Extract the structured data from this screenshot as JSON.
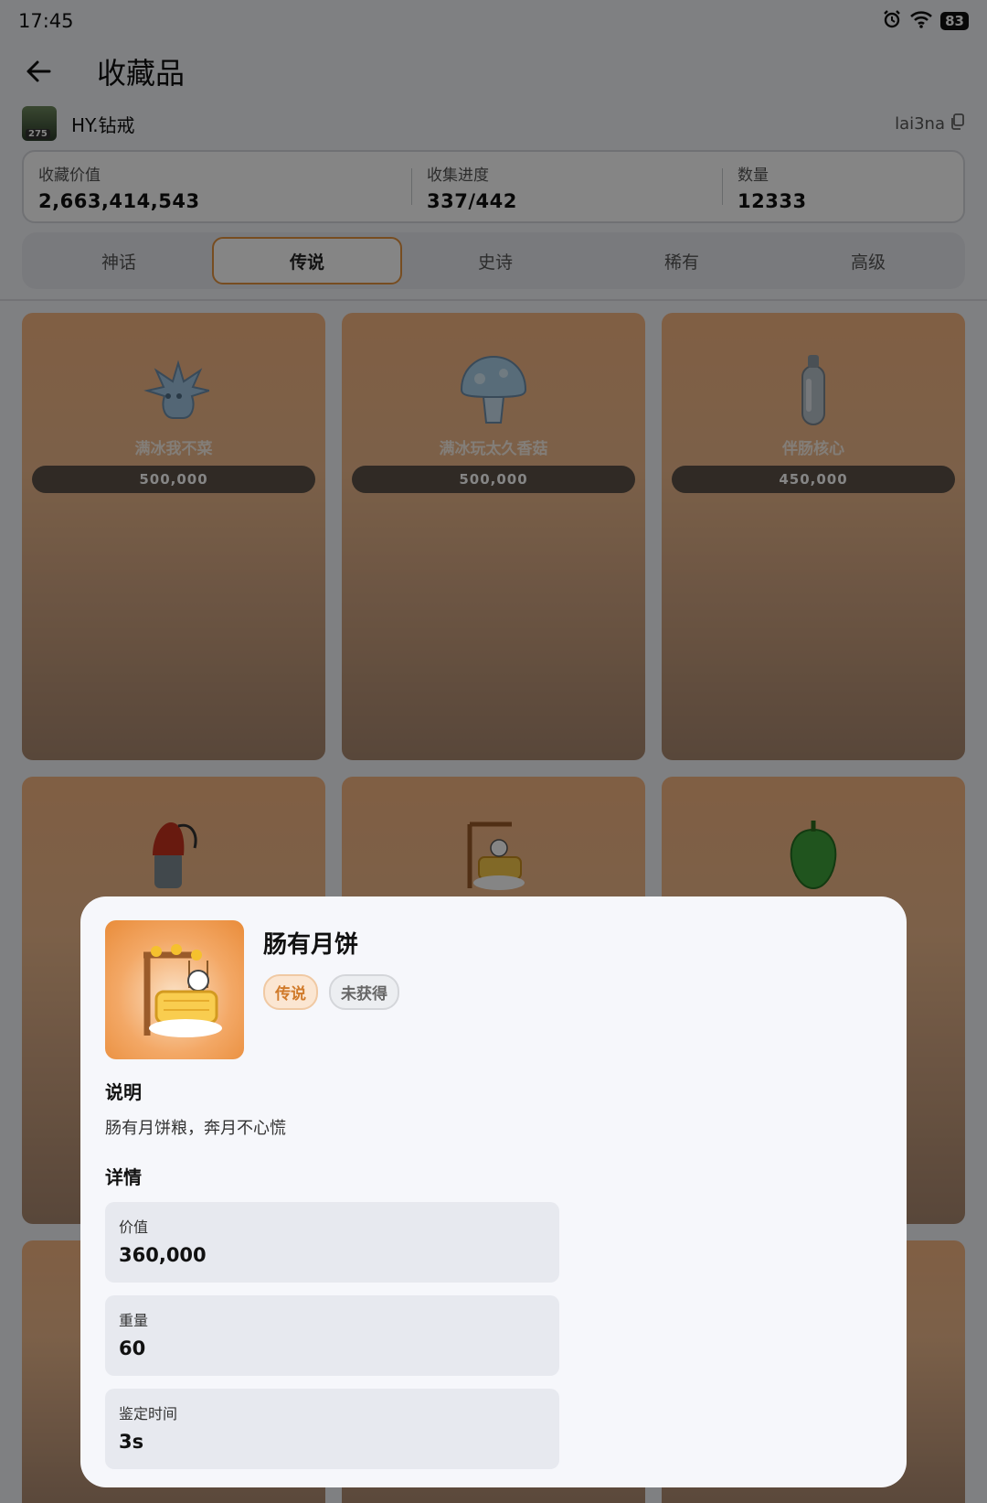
{
  "status_bar": {
    "time": "17:45",
    "battery": "83"
  },
  "header": {
    "title": "收藏品"
  },
  "user": {
    "name": "HY.钻戒",
    "level": "275",
    "id": "lai3na"
  },
  "stats": [
    {
      "label": "收藏价值",
      "value": "2,663,414,543"
    },
    {
      "label": "收集进度",
      "value": "337/442"
    },
    {
      "label": "数量",
      "value": "12333"
    }
  ],
  "tabs": [
    {
      "label": "神话",
      "active": false
    },
    {
      "label": "传说",
      "active": true
    },
    {
      "label": "史诗",
      "active": false
    },
    {
      "label": "稀有",
      "active": false
    },
    {
      "label": "高级",
      "active": false
    }
  ],
  "cards": [
    {
      "name": "满冰我不菜",
      "price": "500,000",
      "icon": "ice-bird-icon"
    },
    {
      "name": "满冰玩太久香菇",
      "price": "500,000",
      "icon": "ice-mushroom-icon"
    },
    {
      "name": "伴肠核心",
      "price": "450,000",
      "icon": "capsule-icon"
    },
    {
      "icon": "sausage-bomb-icon"
    },
    {
      "icon": "mooncake-swing-icon"
    },
    {
      "icon": "green-pepper-icon"
    }
  ],
  "modal": {
    "title": "肠有月饼",
    "rarity": "传说",
    "status": "未获得",
    "description_heading": "说明",
    "description": "肠有月饼粮，奔月不心慌",
    "details_heading": "详情",
    "details": [
      {
        "label": "价值",
        "value": "360,000"
      },
      {
        "label": "重量",
        "value": "60"
      },
      {
        "label": "鉴定时间",
        "value": "3s"
      }
    ]
  },
  "colors": {
    "accent": "#e49440",
    "rarity_badge_bg": "#fbe6d2",
    "rarity_badge_text": "#d07a2a"
  }
}
